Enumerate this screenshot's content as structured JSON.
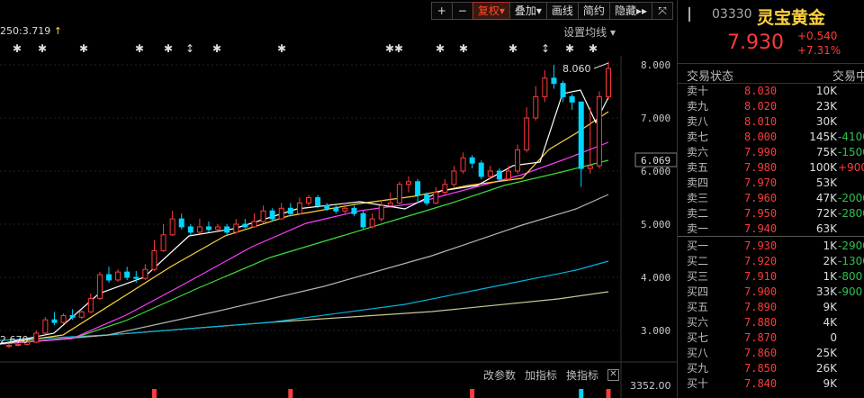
{
  "toolbar": {
    "plus": "+",
    "minus": "−",
    "adjust": "复权",
    "overlay": "叠加",
    "draw": "画线",
    "simple": "简约",
    "hide": "隐藏",
    "hide_arrows": "▸▸",
    "fullscreen_icon": "⤧",
    "caret": "▾"
  },
  "chart": {
    "ma_label": "250:3.719",
    "ma_arrow": "↑",
    "ma_setting": "设置均线",
    "ma_setting_caret": "▾",
    "high_label": "8.060",
    "low_label": "2.670",
    "current_price_tag": "6.069",
    "y_ticks": [
      "8.000",
      "7.000",
      "6.000",
      "5.000",
      "4.000",
      "3.000"
    ],
    "indicator_params": "改参数",
    "indicator_add": "加指标",
    "indicator_switch": "换指标",
    "indicator_close": "✕",
    "volume_value": "3352.00",
    "colors": {
      "up": "#ff3b3b",
      "down": "#00d5ff",
      "ma5": "#ffffff",
      "ma10": "#ffd23c",
      "ma20": "#ff3cff",
      "ma30": "#3cdc3c",
      "ma60": "#b4b4b4",
      "ma120": "#00b4dc",
      "ma250": "#c8c896"
    }
  },
  "quote": {
    "code": "03330",
    "name": "灵宝黄金",
    "price": "7.930",
    "change": "+0.540",
    "change_pct": "+7.31%",
    "status_label": "交易状态",
    "status_value": "交易中",
    "asks": [
      {
        "label": "卖十",
        "price": "8.030",
        "volume": "10K",
        "delta": ""
      },
      {
        "label": "卖九",
        "price": "8.020",
        "volume": "23K",
        "delta": ""
      },
      {
        "label": "卖八",
        "price": "8.010",
        "volume": "30K",
        "delta": ""
      },
      {
        "label": "卖七",
        "price": "8.000",
        "volume": "145K",
        "delta": "-4100"
      },
      {
        "label": "卖六",
        "price": "7.990",
        "volume": "75K",
        "delta": "-1500"
      },
      {
        "label": "卖五",
        "price": "7.980",
        "volume": "100K",
        "delta": "+900"
      },
      {
        "label": "卖四",
        "price": "7.970",
        "volume": "53K",
        "delta": ""
      },
      {
        "label": "卖三",
        "price": "7.960",
        "volume": "47K",
        "delta": "-2000"
      },
      {
        "label": "卖二",
        "price": "7.950",
        "volume": "72K",
        "delta": "-2800"
      },
      {
        "label": "卖一",
        "price": "7.940",
        "volume": "63K",
        "delta": ""
      }
    ],
    "bids": [
      {
        "label": "买一",
        "price": "7.930",
        "volume": "1K",
        "delta": "-2900"
      },
      {
        "label": "买二",
        "price": "7.920",
        "volume": "2K",
        "delta": "-1300"
      },
      {
        "label": "买三",
        "price": "7.910",
        "volume": "1K",
        "delta": "-800"
      },
      {
        "label": "买四",
        "price": "7.900",
        "volume": "33K",
        "delta": "-900"
      },
      {
        "label": "买五",
        "price": "7.890",
        "volume": "9K",
        "delta": ""
      },
      {
        "label": "买六",
        "price": "7.880",
        "volume": "4K",
        "delta": ""
      },
      {
        "label": "买七",
        "price": "7.870",
        "volume": "0",
        "delta": ""
      },
      {
        "label": "买八",
        "price": "7.860",
        "volume": "25K",
        "delta": ""
      },
      {
        "label": "买九",
        "price": "7.850",
        "volume": "26K",
        "delta": ""
      },
      {
        "label": "买十",
        "price": "7.840",
        "volume": "9K",
        "delta": ""
      }
    ]
  }
}
